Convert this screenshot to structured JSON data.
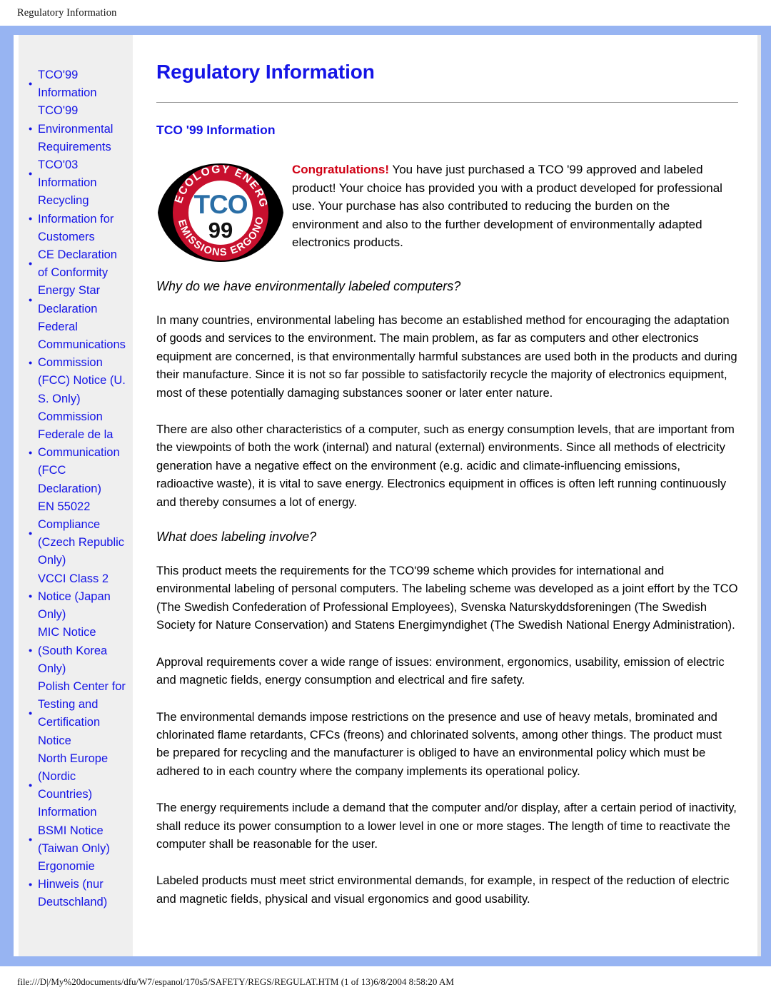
{
  "browser": {
    "header_title": "Regulatory Information",
    "status_path": "file:///D|/My%20documents/dfu/W7/espanol/170s5/SAFETY/REGS/REGULAT.HTM (1 of 13)6/8/2004 8:58:20 AM"
  },
  "colors": {
    "link_blue": "#1414e6",
    "frame_blue": "#97b4f2",
    "sidebar_gray": "#efefef",
    "congrats_red": "#d00014",
    "logo_red": "#c8102e",
    "logo_blue": "#2a6ea6"
  },
  "sidebar": {
    "items": [
      {
        "label": "TCO'99 Information"
      },
      {
        "label": "TCO'99 Environmental Requirements"
      },
      {
        "label": "TCO'03 Information"
      },
      {
        "label": "Recycling Information for Customers"
      },
      {
        "label": "CE Declaration of Conformity"
      },
      {
        "label": "Energy Star Declaration"
      },
      {
        "label": "Federal Communications Commission (FCC) Notice (U. S. Only)"
      },
      {
        "label": "Commission Federale de la Communication (FCC Declaration)"
      },
      {
        "label": "EN 55022 Compliance (Czech Republic Only)"
      },
      {
        "label": "VCCI Class 2 Notice (Japan Only)"
      },
      {
        "label": "MIC Notice (South Korea Only)"
      },
      {
        "label": "Polish Center for Testing and Certification Notice"
      },
      {
        "label": "North Europe (Nordic Countries) Information"
      },
      {
        "label": "BSMI Notice (Taiwan Only)"
      },
      {
        "label": "Ergonomie Hinweis (nur Deutschland)"
      }
    ]
  },
  "main": {
    "title": "Regulatory Information",
    "section_title": "TCO '99 Information",
    "logo": {
      "name": "tco-99-approval-logo",
      "top_text_left": "ECOLOGY",
      "top_text_right": "ENERGY",
      "bottom_text_left": "EMISSIONS",
      "bottom_text_right": "ERGONOMICS",
      "center_text": "TCO",
      "center_year": "99"
    },
    "congrats_word": "Congratulations!",
    "congrats_body": " You have just purchased a TCO '99 approved and labeled product! Your choice has provided you with a product developed for professional use. Your purchase has also contributed to reducing the burden on the environment and also to the further development of environmentally adapted electronics products.",
    "heading_why": "Why do we have environmentally labeled computers?",
    "paragraph_1": "In many countries, environmental labeling has become an established method for encouraging the adaptation of goods and services to the environment. The main problem, as far as computers and other electronics equipment are concerned, is that environmentally harmful substances are used both in the products and during their manufacture. Since it is not so far possible to satisfactorily recycle the majority of electronics equipment, most of these potentially damaging substances sooner or later enter nature.",
    "paragraph_2": "There are also other characteristics of a computer, such as energy consumption levels, that are important from the viewpoints of both the work (internal) and natural (external) environments. Since all methods of electricity generation have a negative effect on the environment (e.g. acidic and climate-influencing emissions, radioactive waste), it is vital to save energy. Electronics equipment in offices is often left running continuously and thereby consumes a lot of energy.",
    "heading_what": "What does labeling involve?",
    "paragraph_3": "This product meets the requirements for the TCO'99 scheme which provides for international and environmental labeling of personal computers. The labeling scheme was developed as a joint effort by the TCO (The Swedish Confederation of Professional Employees), Svenska Naturskyddsforeningen (The Swedish Society for Nature Conservation) and Statens Energimyndighet (The Swedish National Energy Administration).",
    "paragraph_4": "Approval requirements cover a wide range of issues: environment, ergonomics, usability, emission of electric and magnetic fields, energy consumption and electrical and fire safety.",
    "paragraph_5": "The environmental demands impose restrictions on the presence and use of heavy metals, brominated and chlorinated flame retardants, CFCs (freons) and chlorinated solvents, among other things. The product must be prepared for recycling and the manufacturer is obliged to have an environmental policy which must be adhered to in each country where the company implements its operational policy.",
    "paragraph_6": "The energy requirements include a demand that the computer and/or display, after a certain period of inactivity, shall reduce its power consumption to a lower level in one or more stages. The length of time to reactivate the computer shall be reasonable for the user.",
    "paragraph_7": "Labeled products must meet strict environmental demands, for example, in respect of the reduction of electric and magnetic fields, physical and visual ergonomics and good usability."
  }
}
